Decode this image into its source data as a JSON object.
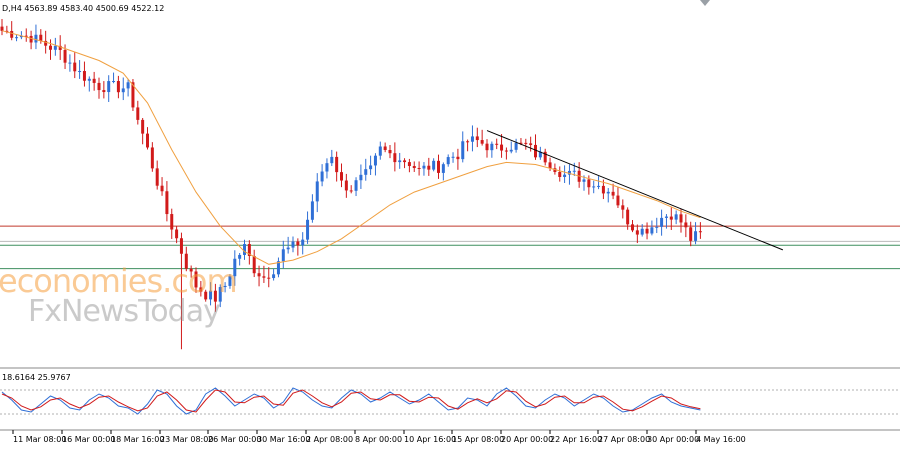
{
  "header": {
    "symbol_info": "D,H4  4563.89 4583.40 4500.69 4522.12"
  },
  "indicator": {
    "header": "18.6164 25.9767"
  },
  "watermark": {
    "brand": "economies.com",
    "sub": "FxNewsToday"
  },
  "colors": {
    "background": "#ffffff",
    "bull_candle": "#2f6fd6",
    "bear_candle": "#d11a1a",
    "moving_average": "#f0a040",
    "trendline": "#000000",
    "resistance_line": "#c0392b",
    "support_line": "#3f8f5f",
    "stoch_main": "#2f6fd6",
    "stoch_signal": "#d11a1a"
  },
  "chart_data": {
    "type": "candlestick",
    "x_ticks": [
      "11 Mar 08:00",
      "16 Mar 00:00",
      "18 Mar 16:00",
      "23 Mar 08:00",
      "26 Mar 00:00",
      "30 Mar 16:00",
      "2 Apr 08:00",
      "8 Apr 00:00",
      "10 Apr 16:00",
      "15 Apr 08:00",
      "20 Apr 00:00",
      "22 Apr 16:00",
      "27 Apr 08:00",
      "30 Apr 00:00",
      "4 May 16:00"
    ],
    "ylim": [
      4150,
      4960
    ],
    "anchors": [
      [
        0,
        4930
      ],
      [
        6,
        4915
      ],
      [
        12,
        4880
      ],
      [
        16,
        4830
      ],
      [
        20,
        4800
      ],
      [
        26,
        4795
      ],
      [
        30,
        4650
      ],
      [
        34,
        4500
      ],
      [
        38,
        4380
      ],
      [
        40,
        4330
      ],
      [
        42,
        4310
      ],
      [
        44,
        4300
      ],
      [
        46,
        4330
      ],
      [
        48,
        4390
      ],
      [
        50,
        4420
      ],
      [
        52,
        4370
      ],
      [
        54,
        4350
      ],
      [
        56,
        4370
      ],
      [
        58,
        4410
      ],
      [
        60,
        4420
      ],
      [
        62,
        4440
      ],
      [
        64,
        4530
      ],
      [
        66,
        4600
      ],
      [
        68,
        4640
      ],
      [
        70,
        4570
      ],
      [
        72,
        4560
      ],
      [
        74,
        4580
      ],
      [
        76,
        4600
      ],
      [
        78,
        4650
      ],
      [
        80,
        4640
      ],
      [
        82,
        4630
      ],
      [
        84,
        4620
      ],
      [
        86,
        4600
      ],
      [
        88,
        4610
      ],
      [
        90,
        4610
      ],
      [
        92,
        4630
      ],
      [
        94,
        4640
      ],
      [
        96,
        4670
      ],
      [
        98,
        4670
      ],
      [
        100,
        4660
      ],
      [
        102,
        4650
      ],
      [
        104,
        4660
      ],
      [
        106,
        4660
      ],
      [
        108,
        4660
      ],
      [
        110,
        4640
      ],
      [
        112,
        4630
      ],
      [
        114,
        4610
      ],
      [
        116,
        4590
      ],
      [
        118,
        4590
      ],
      [
        120,
        4580
      ],
      [
        122,
        4570
      ],
      [
        124,
        4560
      ],
      [
        126,
        4550
      ],
      [
        128,
        4500
      ],
      [
        130,
        4470
      ],
      [
        132,
        4460
      ],
      [
        134,
        4470
      ],
      [
        136,
        4490
      ],
      [
        138,
        4500
      ],
      [
        140,
        4480
      ],
      [
        142,
        4440
      ],
      [
        144,
        4450
      ]
    ],
    "moving_average": [
      [
        0,
        4930
      ],
      [
        10,
        4900
      ],
      [
        20,
        4860
      ],
      [
        25,
        4830
      ],
      [
        30,
        4760
      ],
      [
        35,
        4650
      ],
      [
        40,
        4550
      ],
      [
        45,
        4470
      ],
      [
        50,
        4410
      ],
      [
        55,
        4380
      ],
      [
        60,
        4390
      ],
      [
        65,
        4410
      ],
      [
        70,
        4440
      ],
      [
        75,
        4480
      ],
      [
        80,
        4520
      ],
      [
        85,
        4550
      ],
      [
        90,
        4570
      ],
      [
        95,
        4590
      ],
      [
        100,
        4610
      ],
      [
        104,
        4620
      ],
      [
        110,
        4615
      ],
      [
        115,
        4600
      ],
      [
        120,
        4585
      ],
      [
        125,
        4570
      ],
      [
        130,
        4550
      ],
      [
        135,
        4530
      ],
      [
        140,
        4505
      ],
      [
        144,
        4490
      ]
    ],
    "trendline": [
      [
        100,
        4695
      ],
      [
        161,
        4414
      ]
    ],
    "horizontal_levels": [
      {
        "price": 4470,
        "kind": "resistance"
      },
      {
        "price": 4434,
        "kind": "minor"
      },
      {
        "price": 4425,
        "kind": "support"
      },
      {
        "price": 4370,
        "kind": "support"
      }
    ],
    "stochastic": {
      "ylim": [
        0,
        100
      ],
      "main": [
        [
          0,
          75
        ],
        [
          2,
          55
        ],
        [
          4,
          30
        ],
        [
          6,
          25
        ],
        [
          8,
          45
        ],
        [
          10,
          65
        ],
        [
          12,
          55
        ],
        [
          14,
          35
        ],
        [
          16,
          30
        ],
        [
          18,
          55
        ],
        [
          20,
          70
        ],
        [
          22,
          60
        ],
        [
          24,
          40
        ],
        [
          26,
          35
        ],
        [
          28,
          20
        ],
        [
          30,
          45
        ],
        [
          32,
          80
        ],
        [
          34,
          70
        ],
        [
          36,
          40
        ],
        [
          38,
          20
        ],
        [
          40,
          30
        ],
        [
          42,
          70
        ],
        [
          44,
          85
        ],
        [
          46,
          65
        ],
        [
          48,
          40
        ],
        [
          50,
          55
        ],
        [
          52,
          70
        ],
        [
          54,
          60
        ],
        [
          56,
          35
        ],
        [
          58,
          50
        ],
        [
          60,
          85
        ],
        [
          62,
          75
        ],
        [
          64,
          55
        ],
        [
          66,
          40
        ],
        [
          68,
          35
        ],
        [
          70,
          60
        ],
        [
          72,
          80
        ],
        [
          74,
          70
        ],
        [
          76,
          50
        ],
        [
          78,
          60
        ],
        [
          80,
          75
        ],
        [
          82,
          60
        ],
        [
          84,
          45
        ],
        [
          86,
          55
        ],
        [
          88,
          70
        ],
        [
          90,
          50
        ],
        [
          92,
          30
        ],
        [
          94,
          35
        ],
        [
          96,
          60
        ],
        [
          98,
          55
        ],
        [
          100,
          40
        ],
        [
          102,
          70
        ],
        [
          104,
          85
        ],
        [
          106,
          65
        ],
        [
          108,
          40
        ],
        [
          110,
          35
        ],
        [
          112,
          55
        ],
        [
          114,
          70
        ],
        [
          116,
          60
        ],
        [
          118,
          40
        ],
        [
          120,
          55
        ],
        [
          122,
          70
        ],
        [
          124,
          60
        ],
        [
          126,
          40
        ],
        [
          128,
          25
        ],
        [
          130,
          30
        ],
        [
          132,
          45
        ],
        [
          134,
          60
        ],
        [
          136,
          70
        ],
        [
          138,
          50
        ],
        [
          140,
          40
        ],
        [
          142,
          35
        ],
        [
          144,
          30
        ]
      ],
      "signal": [
        [
          0,
          70
        ],
        [
          2,
          60
        ],
        [
          4,
          40
        ],
        [
          6,
          30
        ],
        [
          8,
          38
        ],
        [
          10,
          55
        ],
        [
          12,
          60
        ],
        [
          14,
          45
        ],
        [
          16,
          35
        ],
        [
          18,
          45
        ],
        [
          20,
          62
        ],
        [
          22,
          65
        ],
        [
          24,
          50
        ],
        [
          26,
          38
        ],
        [
          28,
          28
        ],
        [
          30,
          35
        ],
        [
          32,
          65
        ],
        [
          34,
          75
        ],
        [
          36,
          55
        ],
        [
          38,
          30
        ],
        [
          40,
          25
        ],
        [
          42,
          55
        ],
        [
          44,
          80
        ],
        [
          46,
          75
        ],
        [
          48,
          50
        ],
        [
          50,
          48
        ],
        [
          52,
          62
        ],
        [
          54,
          65
        ],
        [
          56,
          45
        ],
        [
          58,
          42
        ],
        [
          60,
          72
        ],
        [
          62,
          80
        ],
        [
          64,
          65
        ],
        [
          66,
          48
        ],
        [
          68,
          38
        ],
        [
          70,
          50
        ],
        [
          72,
          72
        ],
        [
          74,
          75
        ],
        [
          76,
          58
        ],
        [
          78,
          55
        ],
        [
          80,
          68
        ],
        [
          82,
          68
        ],
        [
          84,
          52
        ],
        [
          86,
          50
        ],
        [
          88,
          62
        ],
        [
          90,
          60
        ],
        [
          92,
          40
        ],
        [
          94,
          32
        ],
        [
          96,
          48
        ],
        [
          98,
          58
        ],
        [
          100,
          48
        ],
        [
          102,
          58
        ],
        [
          104,
          78
        ],
        [
          106,
          75
        ],
        [
          108,
          52
        ],
        [
          110,
          38
        ],
        [
          112,
          45
        ],
        [
          114,
          62
        ],
        [
          116,
          65
        ],
        [
          118,
          48
        ],
        [
          120,
          48
        ],
        [
          122,
          62
        ],
        [
          124,
          65
        ],
        [
          126,
          50
        ],
        [
          128,
          32
        ],
        [
          130,
          28
        ],
        [
          132,
          38
        ],
        [
          134,
          52
        ],
        [
          136,
          65
        ],
        [
          138,
          60
        ],
        [
          140,
          45
        ],
        [
          142,
          38
        ],
        [
          144,
          33
        ]
      ],
      "levels": [
        80,
        20
      ]
    }
  }
}
